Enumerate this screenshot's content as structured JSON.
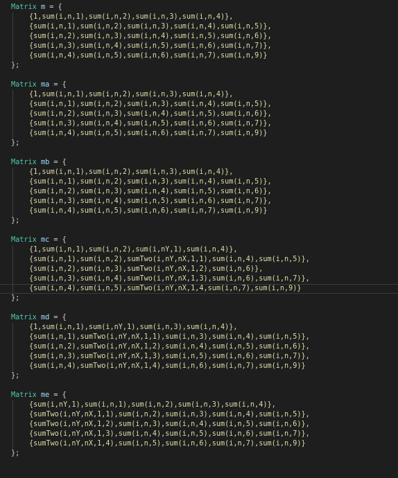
{
  "editor": {
    "blocks": [
      {
        "type": "Matrix",
        "name": "m",
        "open": " = {",
        "rows": [
          "{1,sum(i,n,1),sum(i,n,2),sum(i,n,3),sum(i,n,4)},",
          "{sum(i,n,1),sum(i,n,2),sum(i,n,3),sum(i,n,4),sum(i,n,5)},",
          "{sum(i,n,2),sum(i,n,3),sum(i,n,4),sum(i,n,5),sum(i,n,6)},",
          "{sum(i,n,3),sum(i,n,4),sum(i,n,5),sum(i,n,6),sum(i,n,7)},",
          "{sum(i,n,4),sum(i,n,5),sum(i,n,6),sum(i,n,7),sum(i,n,9)}"
        ],
        "close": "};"
      },
      {
        "type": "Matrix",
        "name": "ma",
        "open": " = {",
        "rows": [
          "{1,sum(i,n,1),sum(i,n,2),sum(i,n,3),sum(i,n,4)},",
          "{sum(i,n,1),sum(i,n,2),sum(i,n,3),sum(i,n,4),sum(i,n,5)},",
          "{sum(i,n,2),sum(i,n,3),sum(i,n,4),sum(i,n,5),sum(i,n,6)},",
          "{sum(i,n,3),sum(i,n,4),sum(i,n,5),sum(i,n,6),sum(i,n,7)},",
          "{sum(i,n,4),sum(i,n,5),sum(i,n,6),sum(i,n,7),sum(i,n,9)}"
        ],
        "close": "};"
      },
      {
        "type": "Matrix",
        "name": "mb",
        "open": " = {",
        "rows": [
          "{1,sum(i,n,1),sum(i,n,2),sum(i,n,3),sum(i,n,4)},",
          "{sum(i,n,1),sum(i,n,2),sum(i,n,3),sum(i,n,4),sum(i,n,5)},",
          "{sum(i,n,2),sum(i,n,3),sum(i,n,4),sum(i,n,5),sum(i,n,6)},",
          "{sum(i,n,3),sum(i,n,4),sum(i,n,5),sum(i,n,6),sum(i,n,7)},",
          "{sum(i,n,4),sum(i,n,5),sum(i,n,6),sum(i,n,7),sum(i,n,9)}"
        ],
        "close": "};"
      },
      {
        "type": "Matrix",
        "name": "mc",
        "open": " = {",
        "rows": [
          "{1,sum(i,n,1),sum(i,n,2),sum(i,nY,1),sum(i,n,4)},",
          "{sum(i,n,1),sum(i,n,2),sumTwo(i,nY,nX,1,1),sum(i,n,4),sum(i,n,5)},",
          "{sum(i,n,2),sum(i,n,3),sumTwo(i,nY,nX,1,2),sum(i,n,6)},",
          "{sum(i,n,3),sum(i,n,4),sumTwo(i,nY,nX,1,3),sum(i,n,6),sum(i,n,7)},",
          "{sum(i,n,4),sum(i,n,5),sumTwo(i,nY,nX,1,4,sum(i,n,7),sum(i,n,9)}"
        ],
        "close": "};"
      },
      {
        "type": "Matrix",
        "name": "md",
        "open": " = {",
        "rows": [
          "{1,sum(i,n,1),sum(i,nY,1),sum(i,n,3),sum(i,n,4)},",
          "{sum(i,n,1),sumTwo(i,nY,nX,1,1),sum(i,n,3),sum(i,n,4),sum(i,n,5)},",
          "{sum(i,n,2),sumTwo(i,nY,nX,1,2),sum(i,n,4),sum(i,n,5),sum(i,n,6)},",
          "{sum(i,n,3),sumTwo(i,nY,nX,1,3),sum(i,n,5),sum(i,n,6),sum(i,n,7)},",
          "{sum(i,n,4),sumTwo(i,nY,nX,1,4),sum(i,n,6),sum(i,n,7),sum(i,n,9)}"
        ],
        "close": "};"
      },
      {
        "type": "Matrix",
        "name": "me",
        "open": " = {",
        "rows": [
          "{sum(i,nY,1),sum(i,n,1),sum(i,n,2),sum(i,n,3),sum(i,n,4)},",
          "{sumTwo(i,nY,nX,1,1),sum(i,n,2),sum(i,n,3),sum(i,n,4),sum(i,n,5)},",
          "{sumTwo(i,nY,nX,1,2),sum(i,n,3),sum(i,n,4),sum(i,n,5),sum(i,n,6)},",
          "{sumTwo(i,nY,nX,1,3),sum(i,n,4),sum(i,n,5),sum(i,n,6),sum(i,n,7)},",
          "{sumTwo(i,nY,nX,1,4),sum(i,n,5),sum(i,n,6),sum(i,n,7),sum(i,n,9)}"
        ],
        "close": "};"
      }
    ],
    "cursor": {
      "block": 3,
      "row": 4
    }
  },
  "colors": {
    "background": "#1e1e1e",
    "type_keyword": "#4ec9b0",
    "variable": "#9cdcfe",
    "function_text": "#dcdcaa",
    "error_squiggle": "#c0392b"
  }
}
